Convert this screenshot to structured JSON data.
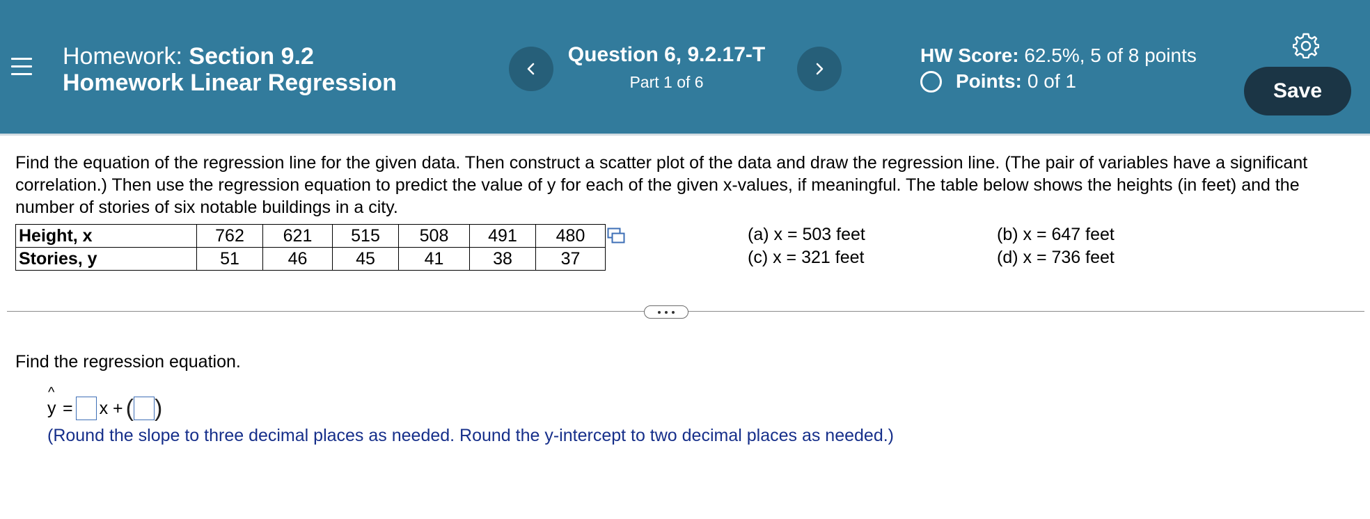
{
  "header": {
    "title_prefix": "Homework:",
    "title_name": "Section 9.2",
    "title_line2": "Homework Linear Regression",
    "question_title": "Question 6, 9.2.17-T",
    "question_part": "Part 1 of 6",
    "hw_score_label": "HW Score:",
    "hw_score_value": "62.5%, 5 of 8 points",
    "points_label": "Points:",
    "points_value": "0 of 1",
    "save_label": "Save"
  },
  "prompt": "Find the equation of the regression line for the given data. Then construct a scatter plot of the data and draw the regression line. (The pair of variables have a significant correlation.) Then use the regression equation to predict the value of y for each of the given x-values, if meaningful. The table below shows the heights (in feet) and the number of stories of six notable buildings in a city.",
  "table": {
    "rows": [
      {
        "label": "Height, x",
        "values": [
          "762",
          "621",
          "515",
          "508",
          "491",
          "480"
        ]
      },
      {
        "label": "Stories, y",
        "values": [
          "51",
          "46",
          "45",
          "41",
          "38",
          "37"
        ]
      }
    ]
  },
  "x_values": {
    "a": "(a) x = 503 feet",
    "b": "(b) x = 647 feet",
    "c": "(c) x = 321 feet",
    "d": "(d) x = 736 feet"
  },
  "answer": {
    "instruction": "Find the regression equation.",
    "yhat_symbol": "y",
    "hat": "^",
    "equals": "=",
    "x_plus": "x +",
    "paren_open": "(",
    "paren_close": ")",
    "slope_value": "",
    "intercept_value": "",
    "round_note": "(Round the slope to three decimal places as needed. Round the y-intercept to two decimal places as needed.)"
  },
  "colors": {
    "header_bg": "#327b9c",
    "save_bg": "#1b3545",
    "note_text": "#162f8a",
    "input_border": "#3e6fb6"
  },
  "icons": {
    "menu": "hamburger-menu-icon",
    "prev": "chevron-left-icon",
    "next": "chevron-right-icon",
    "settings": "gear-icon",
    "copy": "copy-data-icon"
  }
}
